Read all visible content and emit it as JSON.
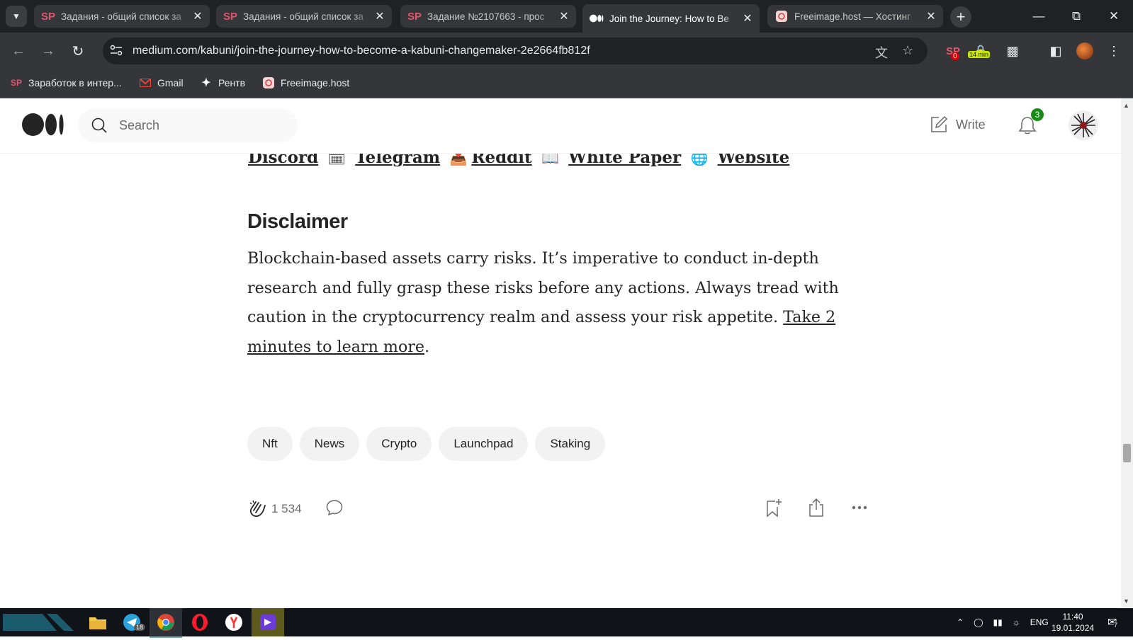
{
  "browser": {
    "tabs": [
      {
        "title": "Задания - общий список за",
        "favicon": "SP",
        "active": false
      },
      {
        "title": "Задания - общий список за",
        "favicon": "SP",
        "active": false
      },
      {
        "title": "Задание №2107663 - прос",
        "favicon": "SP",
        "active": false
      },
      {
        "title": "Join the Journey: How to Be",
        "favicon": "medium-logo",
        "active": true
      },
      {
        "title": "Freeimage.host — Хостинг",
        "favicon": "freeimage-logo",
        "active": false
      }
    ],
    "url": "medium.com/kabuni/join-the-journey-how-to-become-a-kabuni-changemaker-2e2664fb812f",
    "extensions": {
      "sp_badge": "0",
      "timer_badge": "14 min"
    },
    "bookmarks": [
      {
        "label": "Заработок в интер...",
        "icon": "SP"
      },
      {
        "label": "Gmail",
        "icon": "gmail-icon"
      },
      {
        "label": "Рентв",
        "icon": "rentv-icon"
      },
      {
        "label": "Freeimage.host",
        "icon": "freeimage-icon"
      }
    ]
  },
  "medium": {
    "search_placeholder": "Search",
    "write_label": "Write",
    "notification_count": "3",
    "links": {
      "discord": "Discord",
      "telegram": "Telegram",
      "reddit": "Reddit",
      "whitepaper": "White Paper",
      "website": "Website"
    },
    "disclaimer_heading": "Disclaimer",
    "disclaimer_text": "Blockchain-based assets carry risks. It’s imperative to conduct in-depth research and fully grasp these risks before any actions. Always tread with caution in the cryptocurrency realm and assess your risk appetite. ",
    "disclaimer_link": "Take 2 minutes to learn more",
    "disclaimer_end": ".",
    "tags": [
      "Nft",
      "News",
      "Crypto",
      "Launchpad",
      "Staking"
    ],
    "clap_count": "1 534"
  },
  "taskbar": {
    "lang": "ENG",
    "time": "11:40",
    "date": "19.01.2024",
    "telegram_badge": "18",
    "notif_badge": "7"
  },
  "colors": {
    "accent_green": "#1a8917",
    "chrome_dark": "#202124"
  }
}
